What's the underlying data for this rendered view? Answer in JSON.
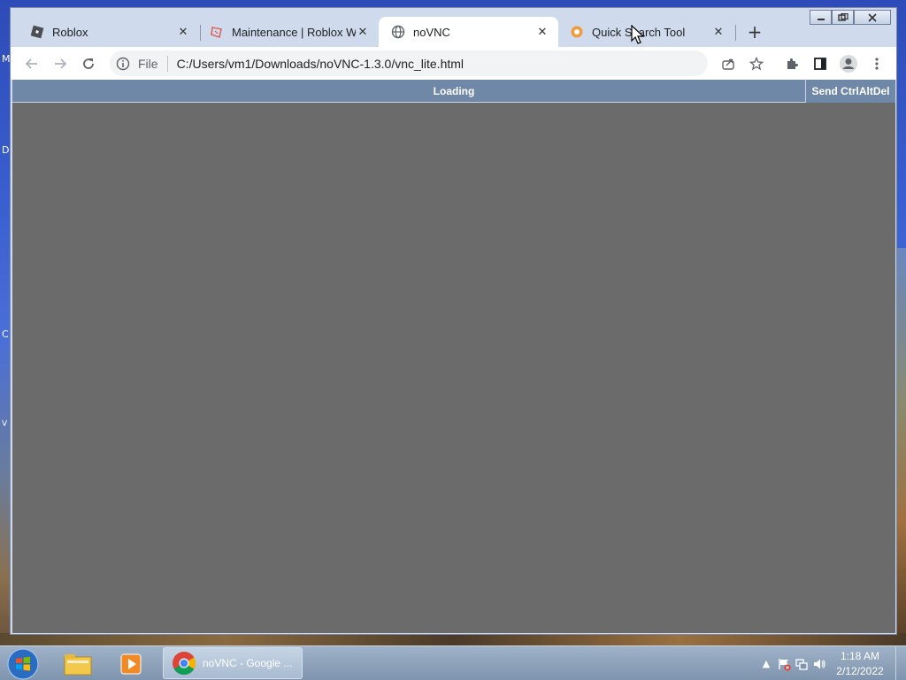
{
  "desktop": {
    "edge_letters": [
      "M",
      "D",
      "C",
      "V"
    ]
  },
  "browser": {
    "tabs": [
      {
        "label": "Roblox",
        "icon": "roblox-icon",
        "active": false
      },
      {
        "label": "Maintenance | Roblox Wiki",
        "icon": "wiki-icon",
        "active": false
      },
      {
        "label": "noVNC",
        "icon": "globe-icon",
        "active": true
      },
      {
        "label": "Quick Search Tool",
        "icon": "search-tool-icon",
        "active": false
      }
    ],
    "new_tab_label": "+",
    "omnibox": {
      "scheme_label": "File",
      "url": "C:/Users/vm1/Downloads/noVNC-1.3.0/vnc_lite.html"
    }
  },
  "novnc": {
    "status": "Loading",
    "send_cad_label": "Send CtrlAltDel",
    "colors": {
      "bar": "#6f88a8",
      "canvas": "#6b6b6b"
    }
  },
  "taskbar": {
    "chrome_item_label": "noVNC - Google ...",
    "clock_time": "1:18 AM",
    "clock_date": "2/12/2022"
  }
}
